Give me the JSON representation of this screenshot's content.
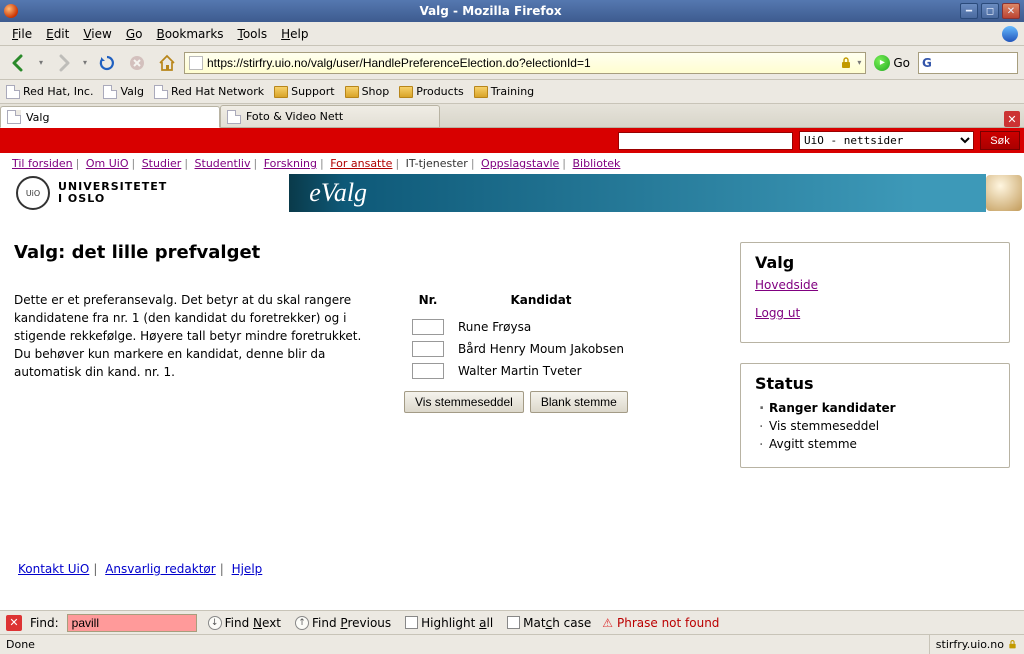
{
  "window": {
    "title": "Valg - Mozilla Firefox"
  },
  "menu": {
    "file": "File",
    "edit": "Edit",
    "view": "View",
    "go": "Go",
    "bookmarks": "Bookmarks",
    "tools": "Tools",
    "help": "Help"
  },
  "nav": {
    "url": "https://stirfry.uio.no/valg/user/HandlePreferenceElection.do?electionId=1",
    "go_label": "Go"
  },
  "bookmarks": [
    {
      "label": "Red Hat, Inc.",
      "type": "page"
    },
    {
      "label": "Valg",
      "type": "page"
    },
    {
      "label": "Red Hat Network",
      "type": "page"
    },
    {
      "label": "Support",
      "type": "folder"
    },
    {
      "label": "Shop",
      "type": "folder"
    },
    {
      "label": "Products",
      "type": "folder"
    },
    {
      "label": "Training",
      "type": "folder"
    }
  ],
  "tabs": [
    {
      "label": "Valg",
      "active": true
    },
    {
      "label": "Foto & Video Nett",
      "active": false
    }
  ],
  "redbar": {
    "dropdown_value": "UiO - nettsider",
    "search_button": "Søk"
  },
  "crumbs": [
    {
      "label": "Til forsiden",
      "link": true
    },
    {
      "label": "Om UiO",
      "link": true
    },
    {
      "label": "Studier",
      "link": true
    },
    {
      "label": "Studentliv",
      "link": true
    },
    {
      "label": "Forskning",
      "link": true
    },
    {
      "label": "For ansatte",
      "link": true,
      "highlight": true
    },
    {
      "label": "IT-tjenester",
      "link": false
    },
    {
      "label": "Oppslagstavle",
      "link": true
    },
    {
      "label": "Bibliotek",
      "link": true
    }
  ],
  "banner": {
    "uio_line1": "UNIVERSITETET",
    "uio_line2": "I OSLO",
    "evalg": "eValg"
  },
  "main": {
    "title": "Valg: det lille prefvalget",
    "intro": "Dette er et preferansevalg. Det betyr at du skal rangere kandidatene fra nr. 1 (den kandidat du foretrekker) og i stigende rekkefølge. Høyere tall betyr mindre foretrukket. Du behøver kun markere en kandidat, denne blir da automatisk din kand. nr. 1.",
    "col_nr": "Nr.",
    "col_kandidat": "Kandidat",
    "candidates": [
      "Rune Frøysa",
      "Bård Henry Moum Jakobsen",
      "Walter Martin Tveter"
    ],
    "btn_vis": "Vis stemmeseddel",
    "btn_blank": "Blank stemme"
  },
  "side_valg": {
    "heading": "Valg",
    "link_home": "Hovedside",
    "link_logout": "Logg ut"
  },
  "side_status": {
    "heading": "Status",
    "steps": [
      {
        "label": "Ranger kandidater",
        "active": true
      },
      {
        "label": "Vis stemmeseddel",
        "active": false
      },
      {
        "label": "Avgitt stemme",
        "active": false
      }
    ]
  },
  "footer": {
    "kontakt": "Kontakt UiO",
    "ansvarlig": "Ansvarlig redaktør",
    "hjelp": "Hjelp"
  },
  "findbar": {
    "label": "Find:",
    "value": "pavill",
    "find_next": "Find Next",
    "find_prev": "Find Previous",
    "highlight": "Highlight all",
    "match_case": "Match case",
    "not_found": "Phrase not found"
  },
  "status": {
    "left": "Done",
    "right": "stirfry.uio.no"
  }
}
